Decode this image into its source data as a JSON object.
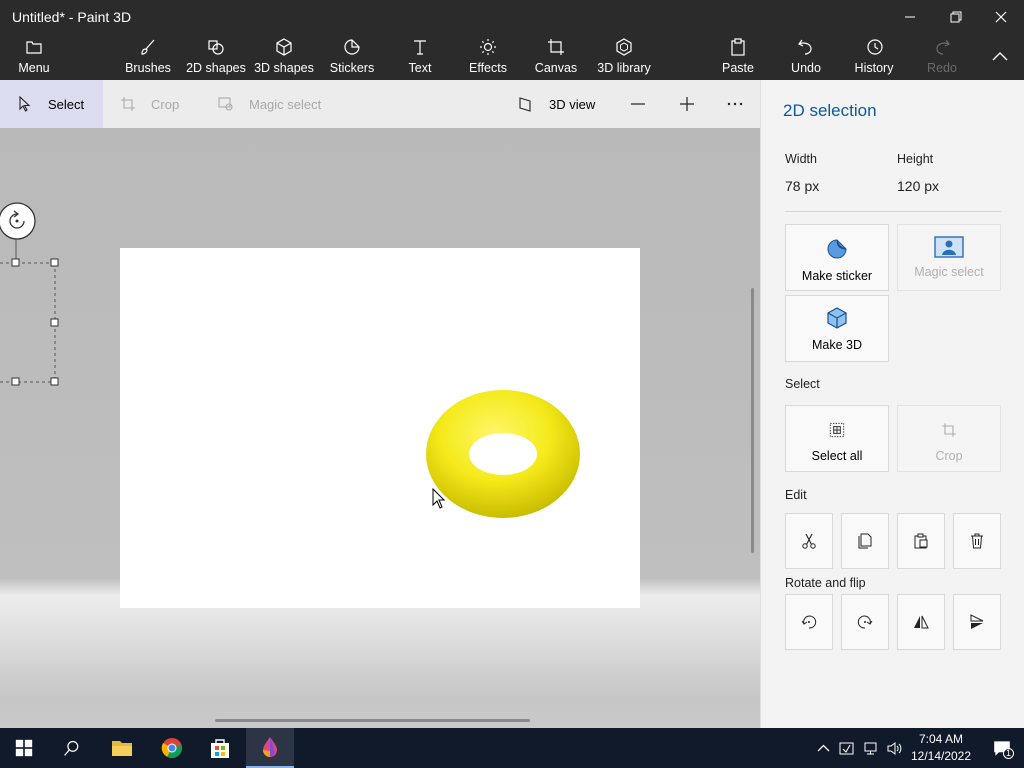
{
  "window": {
    "title": "Untitled* - Paint 3D",
    "minimize_icon": "minimize-icon",
    "restore_icon": "restore-icon",
    "close_icon": "close-icon"
  },
  "ribbon": {
    "menu": "Menu",
    "brushes": "Brushes",
    "shapes2d": "2D shapes",
    "shapes3d": "3D shapes",
    "stickers": "Stickers",
    "text": "Text",
    "effects": "Effects",
    "canvas": "Canvas",
    "library3d": "3D library",
    "paste": "Paste",
    "undo": "Undo",
    "history": "History",
    "redo": "Redo"
  },
  "toolbar": {
    "select": "Select",
    "crop": "Crop",
    "magic_select": "Magic select",
    "view3d": "3D view"
  },
  "panel": {
    "title": "2D selection",
    "width_label": "Width",
    "width_value": "78 px",
    "height_label": "Height",
    "height_value": "120 px",
    "make_sticker": "Make sticker",
    "magic_select": "Magic select",
    "make_3d": "Make 3D",
    "select_section": "Select",
    "select_all": "Select all",
    "crop": "Crop",
    "edit_section": "Edit",
    "rotate_section": "Rotate and flip"
  },
  "taskbar": {
    "time": "7:04 AM",
    "date": "12/14/2022",
    "notification_count": "1"
  },
  "colors": {
    "accent": "#0a5a9c",
    "torus": "#f4ea1a",
    "chrome_dark": "#2b2b2b",
    "taskbar": "#111a2b"
  }
}
